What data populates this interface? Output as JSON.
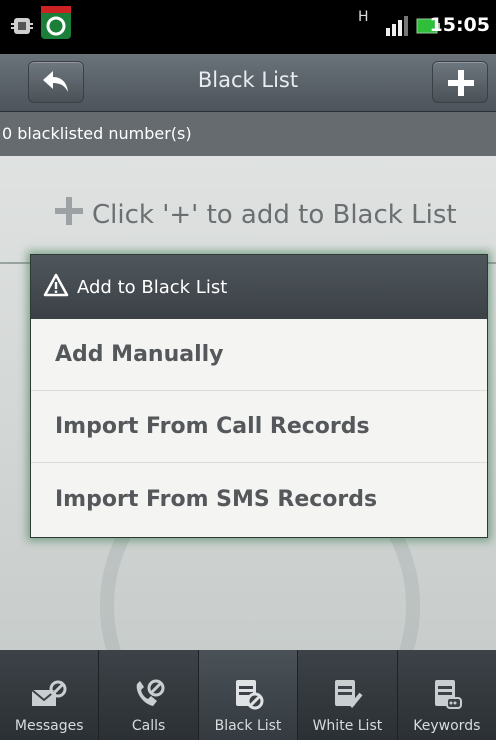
{
  "status_bar": {
    "time": "15:05",
    "network_label": "H"
  },
  "header": {
    "title": "Black List",
    "back_icon": "back-arrow-icon",
    "add_icon": "plus-icon"
  },
  "count_text": "0 blacklisted number(s)",
  "empty_hint": {
    "text": "Click '+' to add to Black List",
    "icon": "plus-icon"
  },
  "dialog": {
    "title": "Add to Black List",
    "title_icon": "warning-icon",
    "items": [
      {
        "label": "Add Manually"
      },
      {
        "label": "Import From Call Records"
      },
      {
        "label": "Import From SMS Records"
      }
    ]
  },
  "tabs": [
    {
      "label": "Messages",
      "icon": "message-block-icon",
      "active": false
    },
    {
      "label": "Calls",
      "icon": "phone-block-icon",
      "active": false
    },
    {
      "label": "Black List",
      "icon": "black-list-icon",
      "active": true
    },
    {
      "label": "White List",
      "icon": "white-list-icon",
      "active": false
    },
    {
      "label": "Keywords",
      "icon": "keywords-icon",
      "active": false
    }
  ],
  "colors": {
    "accent": "#2e7d4a",
    "header_bg": "#5a6168",
    "content_bg": "#d6dad8"
  }
}
